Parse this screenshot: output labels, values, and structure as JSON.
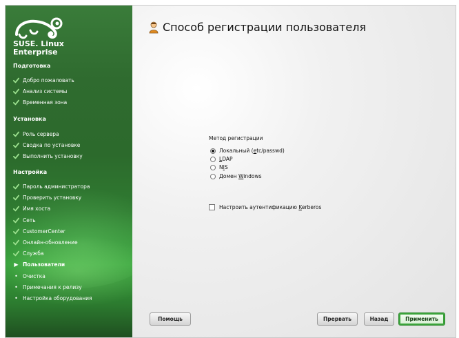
{
  "sidebar": {
    "brand": {
      "line1": "SUSE. Linux",
      "line2": "Enterprise"
    },
    "sections": [
      {
        "title": "Подготовка",
        "items": [
          {
            "label": "Добро пожаловать",
            "state": "done"
          },
          {
            "label": "Анализ системы",
            "state": "done"
          },
          {
            "label": "Временная зона",
            "state": "done"
          }
        ]
      },
      {
        "title": "Установка",
        "items": [
          {
            "label": "Роль сервера",
            "state": "done"
          },
          {
            "label": "Сводка по установке",
            "state": "done"
          },
          {
            "label": "Выполнить установку",
            "state": "done"
          }
        ]
      },
      {
        "title": "Настройка",
        "items": [
          {
            "label": "Пароль администратора",
            "state": "done"
          },
          {
            "label": "Проверить установку",
            "state": "done"
          },
          {
            "label": "Имя хоста",
            "state": "done"
          },
          {
            "label": "Сеть",
            "state": "done"
          },
          {
            "label": "CustomerCenter",
            "state": "done"
          },
          {
            "label": "Онлайн-обновление",
            "state": "done"
          },
          {
            "label": "Служба",
            "state": "done"
          },
          {
            "label": "Пользователи",
            "state": "current"
          },
          {
            "label": "Очистка",
            "state": "pending"
          },
          {
            "label": "Примечания к релизу",
            "state": "pending"
          },
          {
            "label": "Настройка оборудования",
            "state": "pending"
          }
        ]
      }
    ]
  },
  "main": {
    "title": "Способ регистрации пользователя",
    "method_label": "Метод регистрации",
    "options": [
      {
        "pre": "Локальный (",
        "ul": "e",
        "post": "tc/passwd)",
        "selected": true
      },
      {
        "pre": "",
        "ul": "L",
        "post": "DAP",
        "selected": false
      },
      {
        "pre": "N",
        "ul": "I",
        "post": "S",
        "selected": false
      },
      {
        "pre": "Домен ",
        "ul": "W",
        "post": "indows",
        "selected": false
      }
    ],
    "kerberos": {
      "pre": "Настроить аутентификацию ",
      "ul": "K",
      "post": "erberos",
      "checked": false
    }
  },
  "buttons": {
    "help": "Помощь",
    "abort": "Прервать",
    "back": "Назад",
    "accept": "Применить"
  },
  "colors": {
    "sidebar_green": "#2f6b2f",
    "accent_green": "#3aa33a"
  }
}
